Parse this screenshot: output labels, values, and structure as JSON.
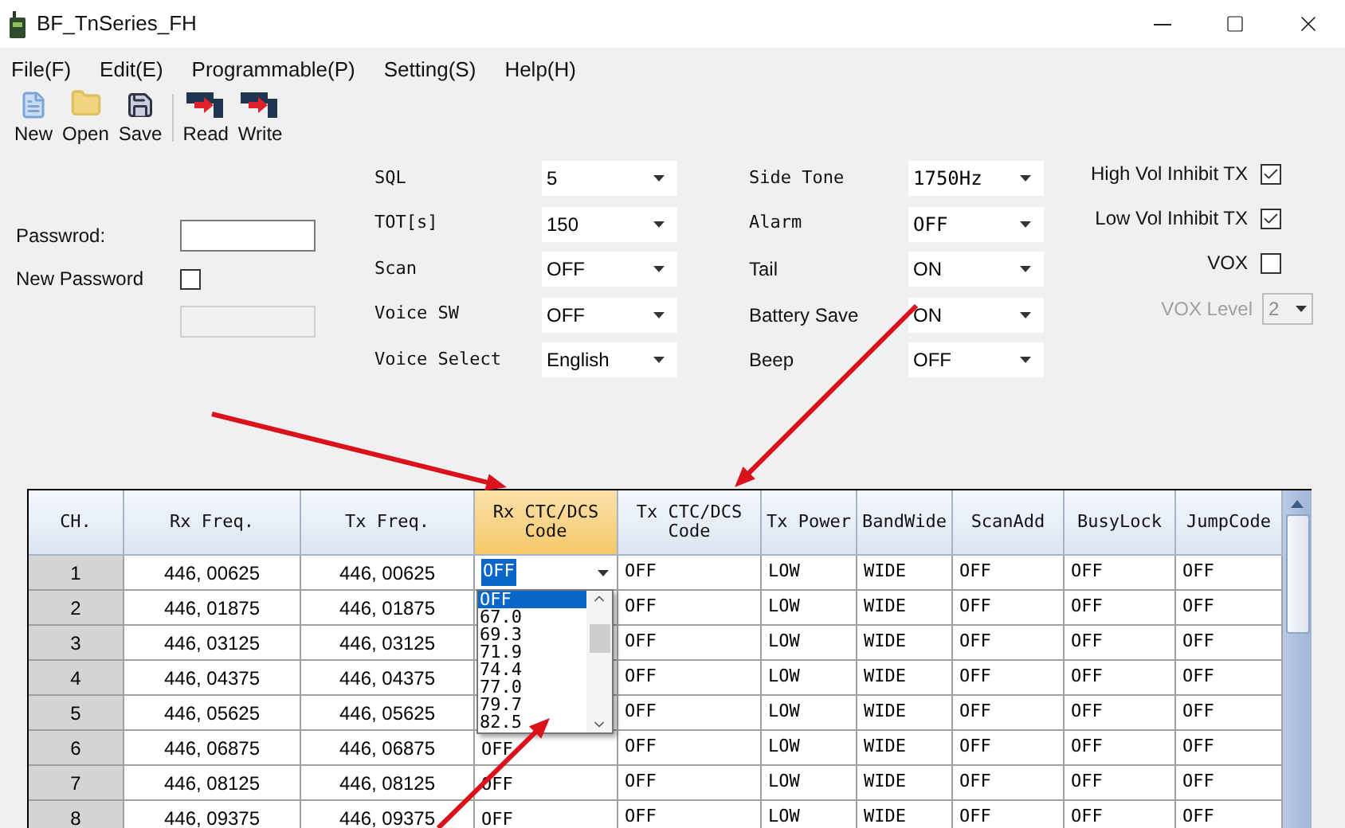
{
  "window": {
    "title": "BF_TnSeries_FH"
  },
  "menu": [
    "File(F)",
    "Edit(E)",
    "Programmable(P)",
    "Setting(S)",
    "Help(H)"
  ],
  "toolbar": [
    {
      "label": "New",
      "kind": "new"
    },
    {
      "label": "Open",
      "kind": "open"
    },
    {
      "label": "Save",
      "kind": "save"
    },
    {
      "label": "Read",
      "kind": "read"
    },
    {
      "label": "Write",
      "kind": "write"
    }
  ],
  "password": {
    "label": "Passwrod:",
    "new_password_label": "New Password",
    "new_password_checked": false
  },
  "settings_1": [
    {
      "label": "SQL",
      "value": "5"
    },
    {
      "label": "TOT[s]",
      "value": "150"
    },
    {
      "label": "Scan",
      "value": "OFF"
    },
    {
      "label": "Voice SW",
      "value": "OFF"
    },
    {
      "label": "Voice Select",
      "value": "English"
    }
  ],
  "settings_2": [
    {
      "label": "Side Tone",
      "value": "1750Hz"
    },
    {
      "label": "Alarm",
      "value": "OFF"
    },
    {
      "label": "Tail",
      "value": "ON"
    },
    {
      "label": "Battery Save",
      "value": "ON"
    },
    {
      "label": "Beep",
      "value": "OFF"
    }
  ],
  "checks": [
    {
      "label": "High Vol Inhibit TX",
      "checked": true
    },
    {
      "label": "Low Vol Inhibit TX",
      "checked": true
    },
    {
      "label": "VOX",
      "checked": false
    }
  ],
  "vox_level": {
    "label": "VOX Level",
    "value": "2",
    "disabled": true
  },
  "table": {
    "columns": [
      {
        "label": "CH.",
        "selected": false
      },
      {
        "label": "Rx Freq.",
        "selected": false
      },
      {
        "label": "Tx Freq.",
        "selected": false
      },
      {
        "label": "Rx CTC/DCS Code",
        "selected": true
      },
      {
        "label": "Tx CTC/DCS Code",
        "selected": false
      },
      {
        "label": "Tx Power",
        "selected": false
      },
      {
        "label": "BandWide",
        "selected": false
      },
      {
        "label": "ScanAdd",
        "selected": false
      },
      {
        "label": "BusyLock",
        "selected": false
      },
      {
        "label": "JumpCode",
        "selected": false
      }
    ],
    "rows": [
      {
        "ch": "1",
        "rx_freq": "446, 00625",
        "tx_freq": "446, 00625",
        "rx_ctc": "OFF",
        "editing": true,
        "tx_ctc": "OFF",
        "tx_power": "LOW",
        "bandwide": "WIDE",
        "scan_add": "OFF",
        "busy_lock": "OFF",
        "jump_code": "OFF"
      },
      {
        "ch": "2",
        "rx_freq": "446, 01875",
        "tx_freq": "446, 01875",
        "editing": false,
        "tx_ctc": "OFF",
        "tx_power": "LOW",
        "bandwide": "WIDE",
        "scan_add": "OFF",
        "busy_lock": "OFF",
        "jump_code": "OFF"
      },
      {
        "ch": "3",
        "rx_freq": "446, 03125",
        "tx_freq": "446, 03125",
        "editing": false,
        "tx_ctc": "OFF",
        "tx_power": "LOW",
        "bandwide": "WIDE",
        "scan_add": "OFF",
        "busy_lock": "OFF",
        "jump_code": "OFF"
      },
      {
        "ch": "4",
        "rx_freq": "446, 04375",
        "tx_freq": "446, 04375",
        "editing": false,
        "tx_ctc": "OFF",
        "tx_power": "LOW",
        "bandwide": "WIDE",
        "scan_add": "OFF",
        "busy_lock": "OFF",
        "jump_code": "OFF"
      },
      {
        "ch": "5",
        "rx_freq": "446, 05625",
        "tx_freq": "446, 05625",
        "editing": false,
        "tx_ctc": "OFF",
        "tx_power": "LOW",
        "bandwide": "WIDE",
        "scan_add": "OFF",
        "busy_lock": "OFF",
        "jump_code": "OFF"
      },
      {
        "ch": "6",
        "rx_freq": "446, 06875",
        "tx_freq": "446, 06875",
        "rx_ctc": "OFF",
        "editing": false,
        "tx_ctc": "OFF",
        "tx_power": "LOW",
        "bandwide": "WIDE",
        "scan_add": "OFF",
        "busy_lock": "OFF",
        "jump_code": "OFF"
      },
      {
        "ch": "7",
        "rx_freq": "446, 08125",
        "tx_freq": "446, 08125",
        "rx_ctc": "OFF",
        "editing": false,
        "tx_ctc": "OFF",
        "tx_power": "LOW",
        "bandwide": "WIDE",
        "scan_add": "OFF",
        "busy_lock": "OFF",
        "jump_code": "OFF"
      },
      {
        "ch": "8",
        "rx_freq": "446, 09375",
        "tx_freq": "446, 09375",
        "rx_ctc": "OFF",
        "editing": false,
        "tx_ctc": "OFF",
        "tx_power": "LOW",
        "bandwide": "WIDE",
        "scan_add": "OFF",
        "busy_lock": "OFF",
        "jump_code": "OFF"
      }
    ],
    "dropdown": [
      {
        "label": "OFF",
        "selected": true
      },
      {
        "label": "67.0",
        "selected": false
      },
      {
        "label": "69.3",
        "selected": false
      },
      {
        "label": "71.9",
        "selected": false
      },
      {
        "label": "74.4",
        "selected": false
      },
      {
        "label": "77.0",
        "selected": false
      },
      {
        "label": "79.7",
        "selected": false
      },
      {
        "label": "82.5",
        "selected": false
      }
    ]
  }
}
